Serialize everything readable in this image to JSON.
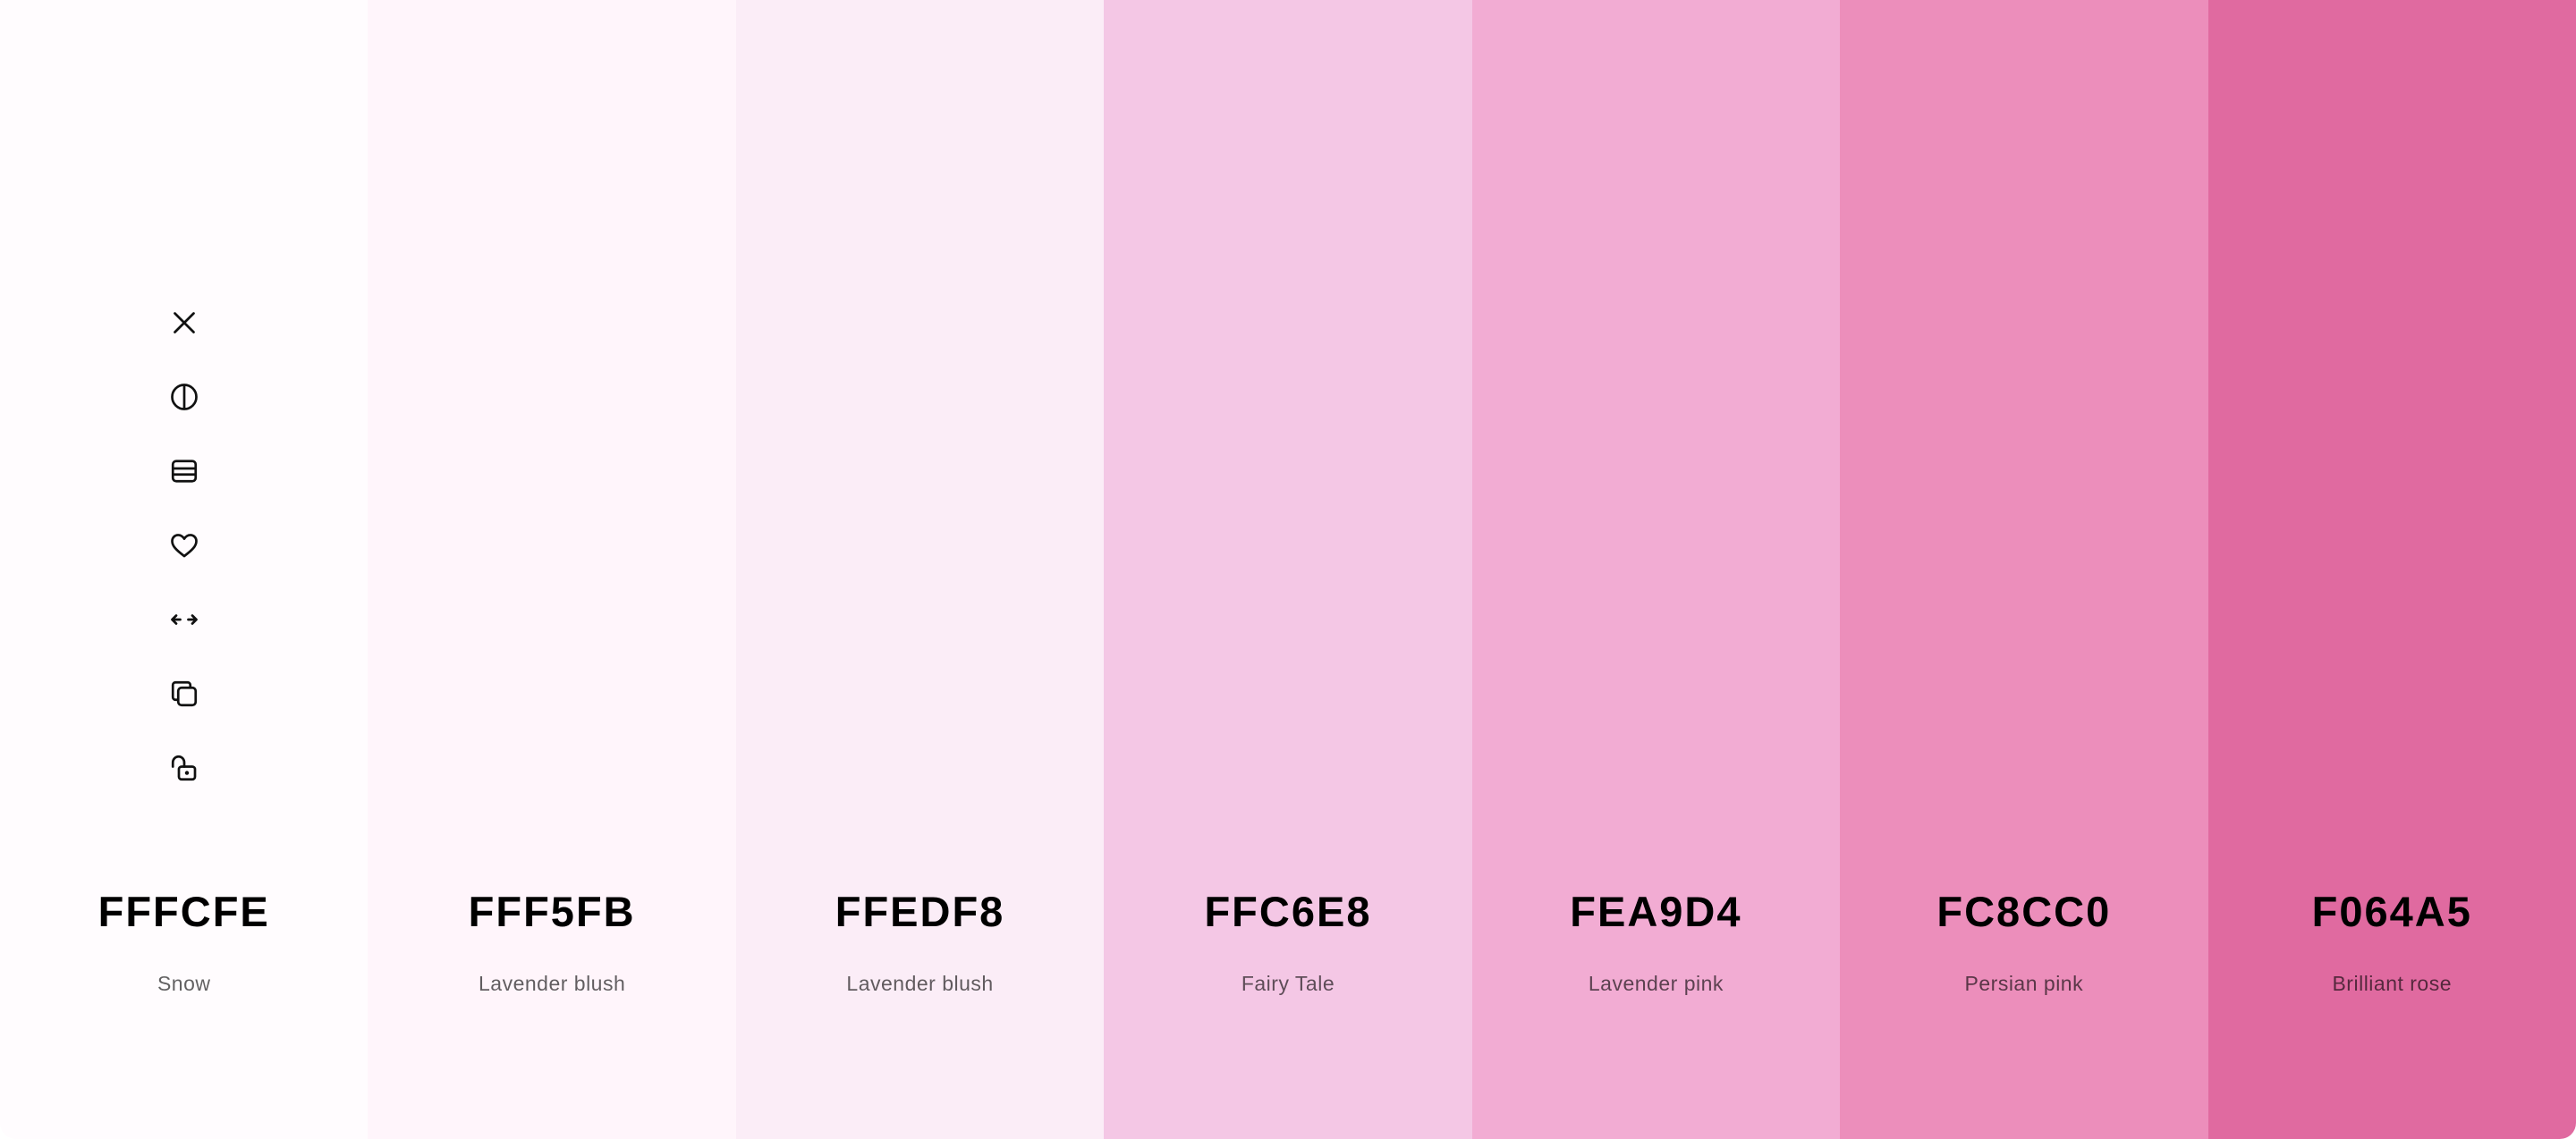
{
  "palette": {
    "swatches": [
      {
        "hex": "FFFCFE",
        "name": "Snow",
        "color": "#FFFCFE"
      },
      {
        "hex": "FFF5FB",
        "name": "Lavender blush",
        "color": "#FFF5FB"
      },
      {
        "hex": "FFEDF8",
        "name": "Lavender blush",
        "color": "#FBEDF7"
      },
      {
        "hex": "FFC6E8",
        "name": "Fairy Tale",
        "color": "#F4C7E5"
      },
      {
        "hex": "FEA9D4",
        "name": "Lavender pink",
        "color": "#F2ACD3"
      },
      {
        "hex": "FC8CC0",
        "name": "Persian pink",
        "color": "#EC8EBB"
      },
      {
        "hex": "F064A5",
        "name": "Brilliant rose",
        "color": "#E06AA0"
      }
    ]
  },
  "toolbar": {
    "icons": [
      "close-icon",
      "contrast-icon",
      "shades-icon",
      "heart-icon",
      "drag-icon",
      "copy-icon",
      "unlock-icon"
    ]
  }
}
